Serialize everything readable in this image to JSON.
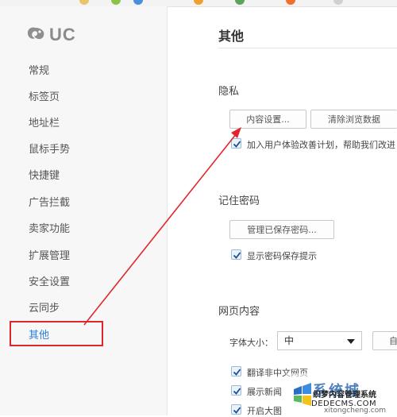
{
  "app": {
    "logo_text": "UC"
  },
  "sidebar": {
    "items": [
      {
        "label": "常规"
      },
      {
        "label": "标签页"
      },
      {
        "label": "地址栏"
      },
      {
        "label": "鼠标手势"
      },
      {
        "label": "快捷键"
      },
      {
        "label": "广告拦截"
      },
      {
        "label": "卖家功能"
      },
      {
        "label": "扩展管理"
      },
      {
        "label": "安全设置"
      },
      {
        "label": "云同步"
      },
      {
        "label": "其他",
        "active": true
      }
    ]
  },
  "main": {
    "title": "其他",
    "privacy": {
      "heading": "隐私",
      "content_settings_button": "内容设置...",
      "clear_data_button": "清除浏览数据",
      "ux_checkbox_label": "加入用户体验改善计划，帮助我们改进",
      "ux_checked": true
    },
    "passwords": {
      "heading": "记住密码",
      "manage_button": "管理已保存密码...",
      "show_prompt_label": "显示密码保存提示",
      "show_prompt_checked": true
    },
    "web_content": {
      "heading": "网页内容",
      "font_size_label": "字体大小：",
      "font_size_value": "中",
      "translate_label": "翻译非中文网页",
      "translate_checked": true,
      "show_new_label": "展示新闻",
      "show_new_checked": true,
      "large_image_label": "开启大图",
      "large_image_checked": true,
      "extra_button_text": "自"
    }
  },
  "watermark": {
    "line1": "系统城",
    "line2": "织梦内容管理系统",
    "line3": "DEDECMS.COM",
    "line4": "xitongcheng.com"
  },
  "colors": {
    "accent": "#2a7de1",
    "annotation": "#e0262c"
  }
}
